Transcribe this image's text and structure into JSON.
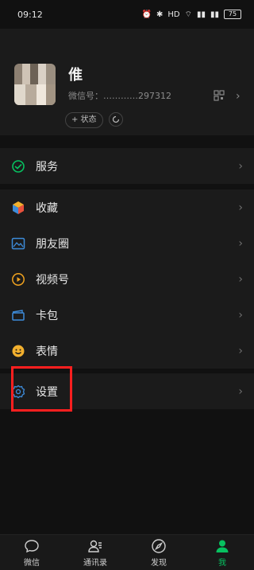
{
  "status_bar": {
    "time": "09:12",
    "signal_1": "≋",
    "battery": "75"
  },
  "profile": {
    "nickname": "倠",
    "wxid": "微信号：…………297312"
  },
  "profile_actions": {
    "status_label": "+ 状态"
  },
  "menu": {
    "services": "服务",
    "favorites": "收藏",
    "moments": "朋友圈",
    "channels": "视频号",
    "cards": "卡包",
    "stickers": "表情",
    "settings": "设置"
  },
  "tabs": {
    "chats": "微信",
    "contacts": "通讯录",
    "discover": "发现",
    "me": "我"
  },
  "colors": {
    "accent": "#07c160",
    "highlight": "#ff1f1f"
  }
}
